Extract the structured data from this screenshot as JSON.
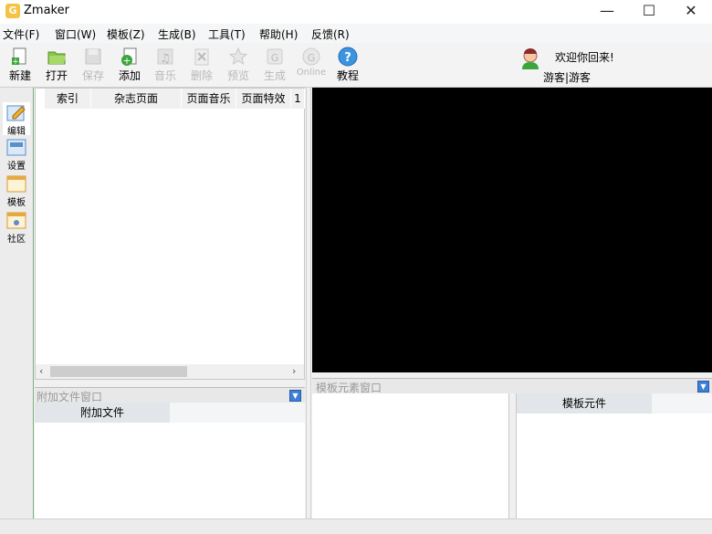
{
  "window": {
    "title": "Zmaker",
    "controls": [
      "—",
      "☐",
      "✕"
    ]
  },
  "menu": [
    "文件(F)",
    "窗口(W)",
    "模板(Z)",
    "生成(B)",
    "工具(T)",
    "帮助(H)",
    "反馈(R)"
  ],
  "toolbar": {
    "new": "新建",
    "open": "打开",
    "save": "保存",
    "add": "添加",
    "music": "音乐",
    "delete": "删除",
    "preview": "预览",
    "generate": "生成",
    "online": "Online",
    "tutorial": "教程"
  },
  "user": {
    "welcome": "欢迎你回来!",
    "name": "游客|游客"
  },
  "sidebar": [
    "编辑",
    "设置",
    "模板",
    "社区"
  ],
  "page_table": {
    "columns": [
      "索引",
      "杂志页面",
      "页面音乐",
      "页面特效",
      "1"
    ]
  },
  "attach_panel": {
    "title": "附加文件窗口",
    "tab": "附加文件"
  },
  "template_panel": {
    "title": "模板元素窗口",
    "tab": "模板元件"
  },
  "colors": {
    "preview_bg": "#000000",
    "sidebar_border": "#7cb07c",
    "accent": "#3b7fd6"
  }
}
